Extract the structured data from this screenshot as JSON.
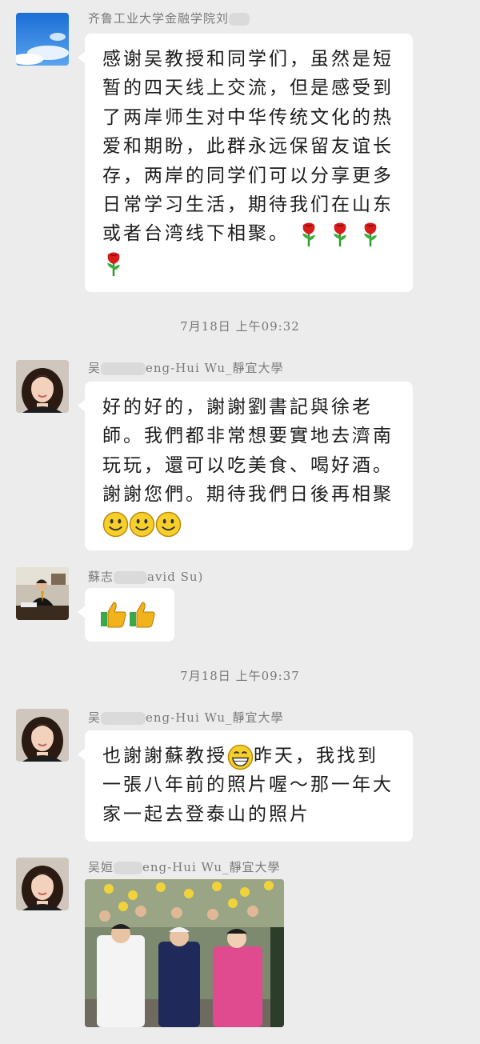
{
  "messages": [
    {
      "sender": "齐鲁工业大学金融学院刘",
      "text": "感谢吴教授和同学们，虽然是短暂的四天线上交流，但是感受到了两岸师生对中华传统文化的热爱和期盼，此群永远保留友谊长存，两岸的同学们可以分享更多日常学习生活，期待我们在山东或者台湾线下相聚。",
      "emoji": "rose-emoji x4"
    },
    {
      "timestamp": "7月18日 上午09:32"
    },
    {
      "sender_prefix": "吴",
      "sender_suffix": "eng-Hui Wu_靜宜大學",
      "text": "好的好的，謝謝劉書記與徐老師。我們都非常想要實地去濟南玩玩，還可以吃美食、喝好酒。謝謝您們。期待我們日後再相聚",
      "emoji": "smile-emoji x3"
    },
    {
      "sender_prefix": "蘇志",
      "sender_suffix": "avid Su)",
      "emoji": "thumbs-up-emoji x2"
    },
    {
      "timestamp": "7月18日 上午09:37"
    },
    {
      "sender_prefix": "吴",
      "sender_suffix": "eng-Hui Wu_靜宜大學",
      "text_before": "也謝謝蘇教授",
      "text_after": "昨天，我找到一張八年前的照片喔～那一年大家一起去登泰山的照片",
      "emoji": "grin-emoji"
    },
    {
      "sender_prefix": "吴姮",
      "sender_suffix": "eng-Hui Wu_靜宜大學",
      "image": "group-photo"
    }
  ],
  "colors": {
    "background": "#ececec",
    "bubble": "#ffffff",
    "rose": "#d81b1b",
    "thumb": "#f2b21b",
    "smile": "#f7cf2a"
  }
}
